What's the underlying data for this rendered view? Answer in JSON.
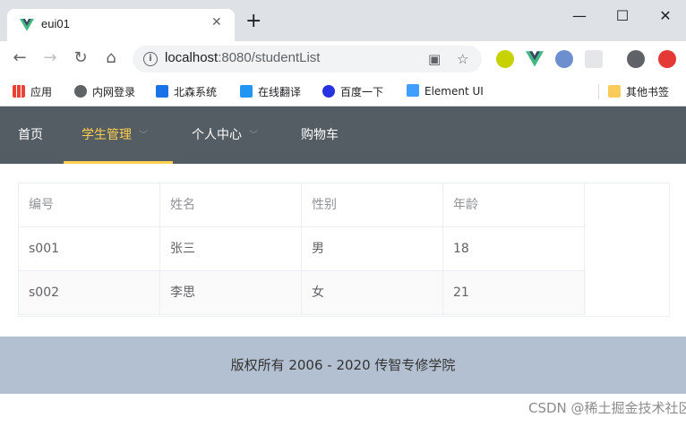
{
  "browser": {
    "tab_title": "eui01",
    "new_tab": "+",
    "url_host": "localhost",
    "url_rest": ":8080/studentList",
    "bookmarks": [
      "应用",
      "内网登录",
      "北森系统",
      "在线翻译",
      "百度一下",
      "Element UI"
    ],
    "other_bookmarks": "其他书签"
  },
  "nav": {
    "items": [
      "首页",
      "学生管理",
      "个人中心",
      "购物车"
    ],
    "active_color": "#ffd04b",
    "bg_color": "#545c64"
  },
  "table": {
    "headers": [
      "编号",
      "姓名",
      "性别",
      "年龄"
    ],
    "rows": [
      [
        "s001",
        "张三",
        "男",
        "18"
      ],
      [
        "s002",
        "李思",
        "女",
        "21"
      ]
    ]
  },
  "footer": {
    "text": "版权所有 2006 - 2020 传智专修学院",
    "bg_color": "#b3c0d1"
  },
  "watermark": "CSDN @稀土掘金技术社区"
}
